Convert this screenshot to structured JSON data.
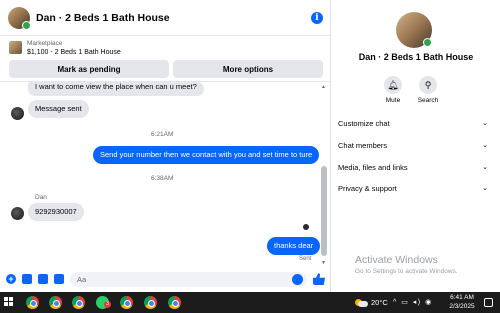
{
  "header": {
    "title": "Dan · 2 Beds 1 Bath House",
    "info_icon": "i"
  },
  "marketplace": {
    "tag": "Marketplace",
    "listing": "$1,100 - 2 Beds 1 Bath House",
    "mark_pending_label": "Mark as pending",
    "more_options_label": "More options"
  },
  "messages": {
    "m1": "I want to come view the place when can u meet?",
    "m2": "Message sent",
    "t1": "6:21AM",
    "m3": "Send your number then we contact with you and set time to ture",
    "t2": "6:38AM",
    "sender": "Dan",
    "m4": "9292930007",
    "m5": "thanks dear",
    "status": "Sent"
  },
  "composer": {
    "placeholder": "Aa",
    "plus_icon": "+"
  },
  "info_panel": {
    "title": "Dan · 2 Beds 1 Bath House",
    "mute_label": "Mute",
    "search_label": "Search",
    "sections": [
      "Customize chat",
      "Chat members",
      "Media, files and links",
      "Privacy & support"
    ],
    "chevron": "⌄"
  },
  "watermark": {
    "title": "Activate Windows",
    "subtitle": "Go to Settings to activate Windows."
  },
  "taskbar": {
    "whatsapp_badge": "3",
    "temperature": "20°C",
    "tray_icons": "^ ▭ ◂) ◉",
    "time": "6:41 AM",
    "date": "2/3/2025"
  },
  "colors": {
    "accent": "#0866ff",
    "bubble_in": "#e4e6eb",
    "taskbar": "#1c1c1c",
    "online": "#31a24c"
  }
}
